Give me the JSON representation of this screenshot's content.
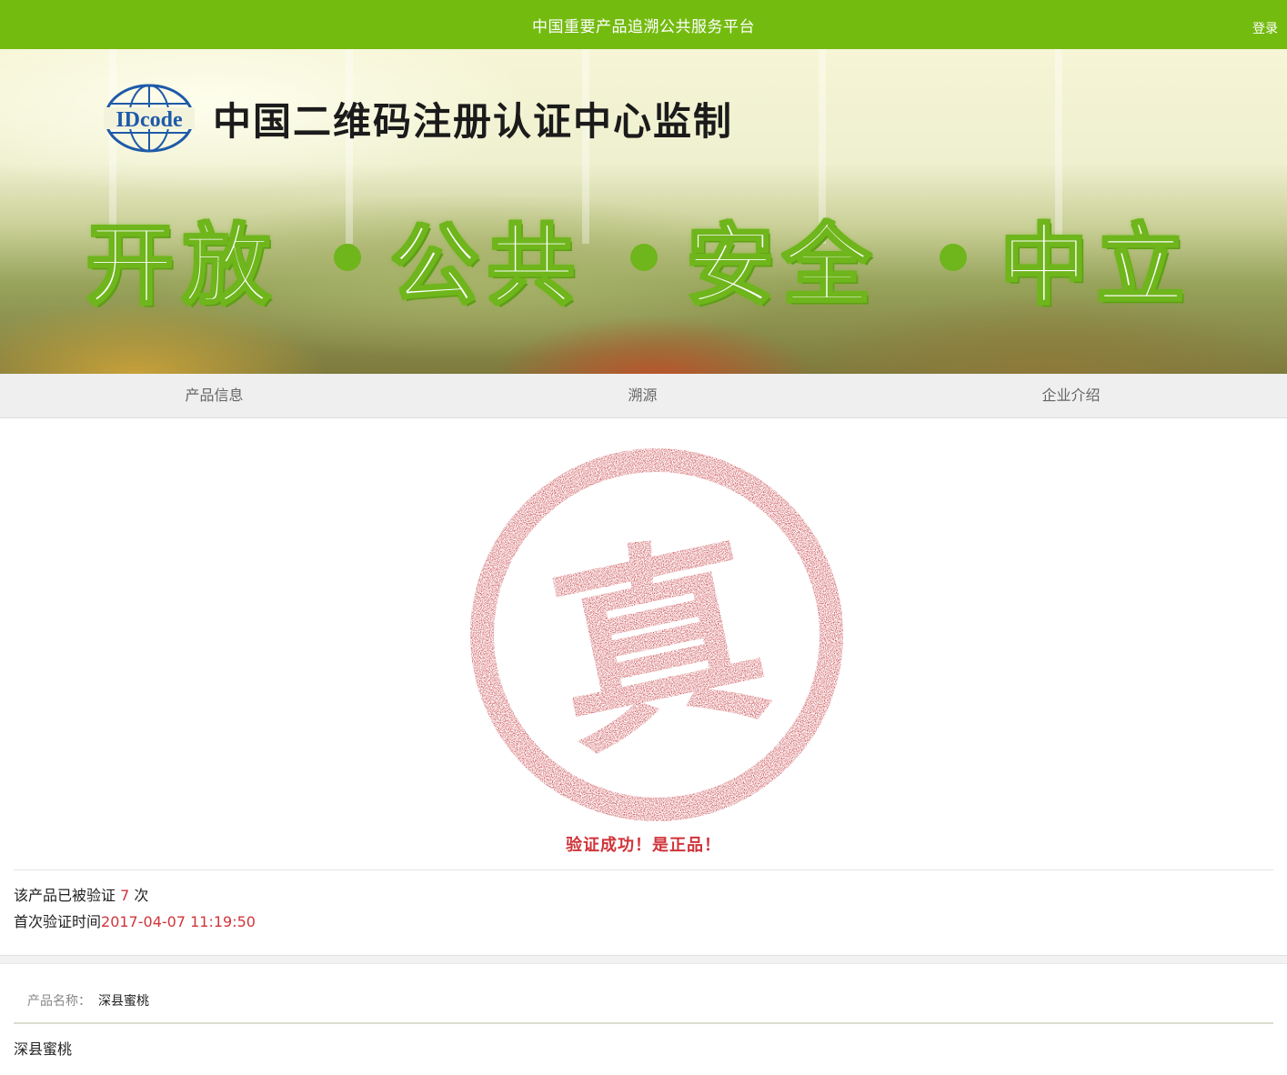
{
  "topbar": {
    "title": "中国重要产品追溯公共服务平台",
    "login_label": "登录",
    "background": "#74bb10"
  },
  "banner": {
    "logo_text": "IDcode",
    "headline": "中国二维码注册认证中心监制",
    "slogan": [
      "开放",
      "公共",
      "安全",
      "中立"
    ],
    "accent_color": "#6fb51c"
  },
  "tabs": [
    {
      "label": "产品信息"
    },
    {
      "label": "溯源"
    },
    {
      "label": "企业介绍"
    }
  ],
  "verification": {
    "stamp_char": "真",
    "stamp_color": "#c0282e",
    "success_text": "验证成功！是正品！",
    "count_prefix": "该产品已被验证",
    "count_value": "7",
    "count_suffix": "次",
    "first_time_label": "首次验证时间",
    "first_time_value": "2017-04-07 11:19:50"
  },
  "product": {
    "name_label": "产品名称：",
    "name_value": "深县蜜桃",
    "description": "深县蜜桃"
  }
}
